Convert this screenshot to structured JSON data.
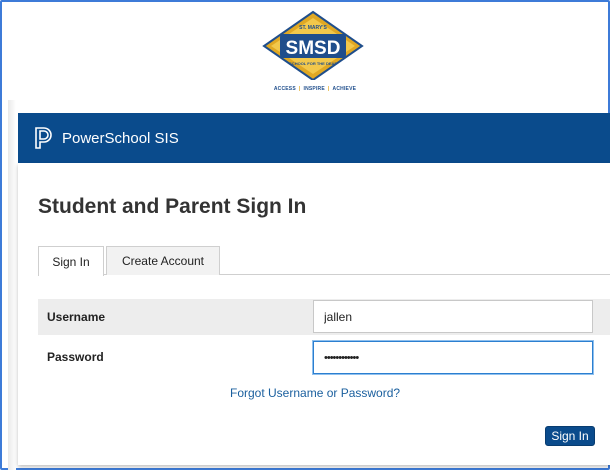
{
  "school": {
    "seal_top": "ST. MARY'S",
    "seal_name": "SMSD",
    "seal_bottom": "SCHOOL FOR THE DEAF",
    "tagline": [
      "ACCESS",
      "INSPIRE",
      "ACHIEVE"
    ],
    "colors": {
      "navy": "#1f4e8c",
      "gold": "#e0a823"
    }
  },
  "header": {
    "product_name": "PowerSchool SIS",
    "icon": "powerschool-logo-icon",
    "bg_color": "#0a4b8c"
  },
  "page": {
    "title": "Student and Parent Sign In"
  },
  "tabs": [
    {
      "label": "Sign In",
      "active": true
    },
    {
      "label": "Create Account",
      "active": false
    }
  ],
  "form": {
    "username_label": "Username",
    "username_value": "jallen",
    "password_label": "Password",
    "password_value": "••••••••••••",
    "forgot_link": "Forgot Username or Password?",
    "submit_label": "Sign In"
  }
}
